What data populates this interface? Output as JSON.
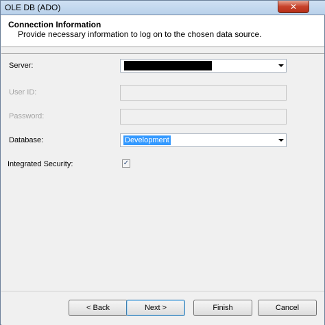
{
  "window": {
    "title": "OLE DB (ADO)",
    "close_label": "✕"
  },
  "header": {
    "title": "Connection Information",
    "description": "Provide necessary information to log on to the chosen data source."
  },
  "form": {
    "server_label": "Server:",
    "userid_label": "User ID:",
    "password_label": "Password:",
    "database_label": "Database:",
    "database_value": "Development",
    "integrated_security_label": "Integrated Security:",
    "integrated_security_checked": true,
    "check_glyph": "✓"
  },
  "buttons": {
    "back": "< Back",
    "next": "Next >",
    "finish": "Finish",
    "cancel": "Cancel"
  },
  "colors": {
    "selection": "#3399ff",
    "close_button": "#c7422b"
  }
}
